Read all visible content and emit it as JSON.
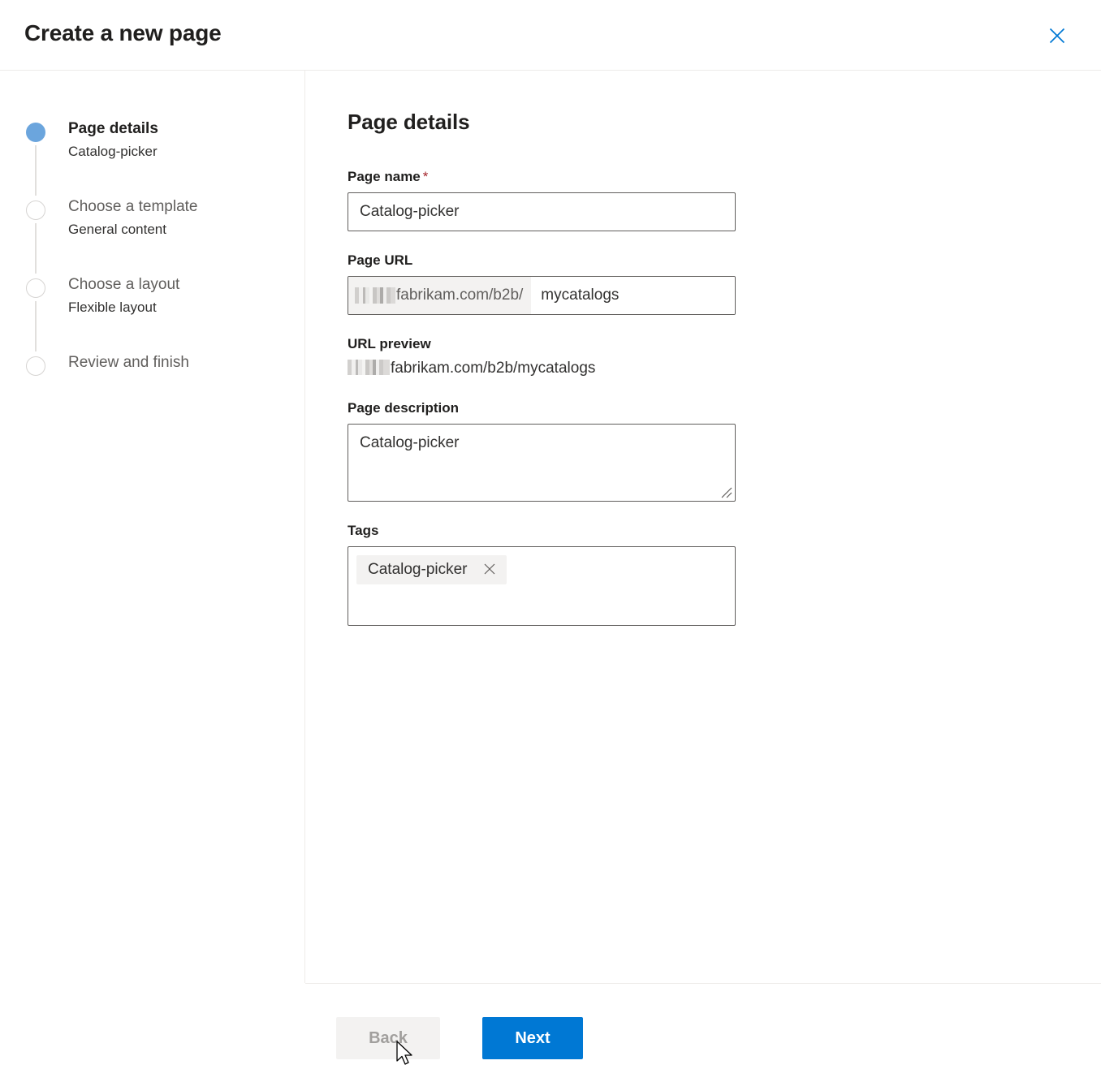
{
  "dialog": {
    "title": "Create a new page",
    "close_icon": "close-icon"
  },
  "steps": [
    {
      "title": "Page details",
      "sub": "Catalog-picker",
      "state": "active"
    },
    {
      "title": "Choose a template",
      "sub": "General content",
      "state": "inactive"
    },
    {
      "title": "Choose a layout",
      "sub": "Flexible layout",
      "state": "inactive"
    },
    {
      "title": "Review and finish",
      "sub": "",
      "state": "inactive"
    }
  ],
  "form": {
    "heading": "Page details",
    "page_name": {
      "label": "Page name",
      "required_marker": "*",
      "value": "Catalog-picker",
      "placeholder": ""
    },
    "page_url": {
      "label": "Page URL",
      "prefix": "fabrikam.com/b2b/",
      "prefix_redacted": true,
      "value": "mycatalogs",
      "placeholder": ""
    },
    "url_preview": {
      "label": "URL preview",
      "value": "fabrikam.com/b2b/mycatalogs"
    },
    "page_description": {
      "label": "Page description",
      "value": "Catalog-picker",
      "placeholder": ""
    },
    "tags": {
      "label": "Tags",
      "chips": [
        {
          "label": "Catalog-picker",
          "remove_icon": "close-icon"
        }
      ]
    }
  },
  "footer": {
    "back_label": "Back",
    "next_label": "Next"
  },
  "colors": {
    "accent": "#0078d4",
    "close_icon": "#0078d4",
    "active_step": "#6ba5dd",
    "required_star": "#a4262c",
    "disabled_button_bg": "#f3f2f1",
    "disabled_button_text": "#a19f9d",
    "chip_bg": "#f3f2f1",
    "border": "#605e5c",
    "divider": "#edebe9"
  }
}
